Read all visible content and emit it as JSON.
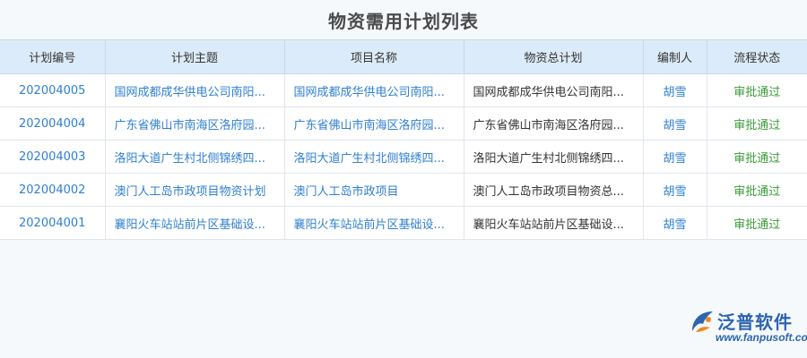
{
  "title": "物资需用计划列表",
  "table": {
    "headers": [
      "计划编号",
      "计划主题",
      "项目名称",
      "物资总计划",
      "编制人",
      "流程状态"
    ],
    "rows": [
      {
        "code": "202004005",
        "theme": "国网成都成华供电公司南阳...",
        "project": "国网成都成华供电公司南阳...",
        "plan": "国网成都成华供电公司南阳...",
        "person": "胡雪",
        "status": "审批通过"
      },
      {
        "code": "202004004",
        "theme": "广东省佛山市南海区洛府园...",
        "project": "广东省佛山市南海区洛府园...",
        "plan": "广东省佛山市南海区洛府园...",
        "person": "胡雪",
        "status": "审批通过"
      },
      {
        "code": "202004003",
        "theme": "洛阳大道广生村北侧锦绣四...",
        "project": "洛阳大道广生村北侧锦绣四...",
        "plan": "洛阳大道广生村北侧锦绣四...",
        "person": "胡雪",
        "status": "审批通过"
      },
      {
        "code": "202004002",
        "theme": "澳门人工岛市政项目物资计划",
        "project": "澳门人工岛市政项目",
        "plan": "澳门人工岛市政项目物资总...",
        "person": "胡雪",
        "status": "审批通过"
      },
      {
        "code": "202004001",
        "theme": "襄阳火车站站前片区基础设...",
        "project": "襄阳火车站站前片区基础设...",
        "plan": "襄阳火车站站前片区基础设...",
        "person": "胡雪",
        "status": "审批通过"
      }
    ]
  },
  "logo": {
    "name": "泛普软件",
    "url": "www.fanpusoft.com",
    "icon": "fanpu-logo-icon"
  },
  "colors": {
    "header_bg": "#dcebf9",
    "link": "#2f7fd0",
    "status_ok": "#3a9a3a",
    "brand": "#2c64b0",
    "logo_orange": "#f08a1c"
  }
}
